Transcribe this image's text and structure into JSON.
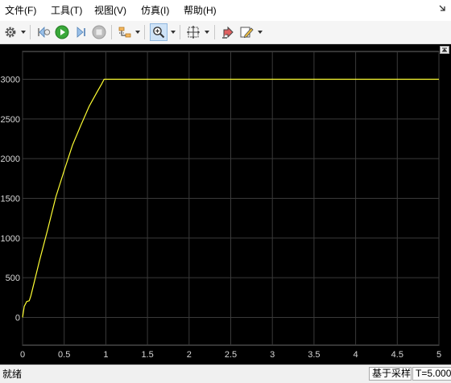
{
  "menu": {
    "items": [
      {
        "label": "文件(F)"
      },
      {
        "label": "工具(T)"
      },
      {
        "label": "视图(V)"
      },
      {
        "label": "仿真(I)"
      },
      {
        "label": "帮助(H)"
      }
    ]
  },
  "toolbar": {
    "buttons": [
      {
        "icon": "gear-icon",
        "has_dropdown": true
      },
      {
        "icon": "step-back-icon"
      },
      {
        "icon": "run-icon"
      },
      {
        "icon": "step-forward-icon"
      },
      {
        "icon": "stop-icon",
        "disabled": true
      },
      {
        "icon": "signal-select-icon",
        "has_dropdown": true
      },
      {
        "icon": "zoom-in-icon",
        "has_dropdown": true,
        "active": true
      },
      {
        "icon": "autoscale-icon",
        "has_dropdown": true
      },
      {
        "icon": "highlight-block-icon"
      },
      {
        "icon": "style-pen-icon",
        "has_dropdown": true
      }
    ]
  },
  "chart_data": {
    "type": "line",
    "title": "",
    "xlabel": "",
    "ylabel": "",
    "xlim": [
      0,
      5
    ],
    "ylim": [
      -350,
      3350
    ],
    "xticks": [
      "0",
      "0.5",
      "1",
      "1.5",
      "2",
      "2.5",
      "3",
      "3.5",
      "4",
      "4.5",
      "5"
    ],
    "yticks": [
      "0",
      "500",
      "1000",
      "1500",
      "2000",
      "2500",
      "3000"
    ],
    "grid": true,
    "background": "#000000",
    "series": [
      {
        "color": "#ffff33",
        "x": [
          0,
          0.02,
          0.05,
          0.08,
          0.1,
          0.2,
          0.3,
          0.4,
          0.5,
          0.6,
          0.7,
          0.8,
          0.9,
          0.95,
          0.98,
          1.0,
          2,
          3,
          4,
          5
        ],
        "y": [
          0,
          140,
          200,
          210,
          270,
          700,
          1100,
          1520,
          1850,
          2170,
          2420,
          2660,
          2850,
          2940,
          3000,
          3000,
          3000,
          3000,
          3000,
          3000
        ]
      }
    ]
  },
  "status": {
    "ready": "就绪",
    "sample_mode": "基于采样",
    "time": "T=5.000"
  },
  "colors": {
    "plot_bg": "#000000",
    "grid": "#3a3a3a",
    "axis_text": "#d8d8d8",
    "line": "#ffff33"
  }
}
